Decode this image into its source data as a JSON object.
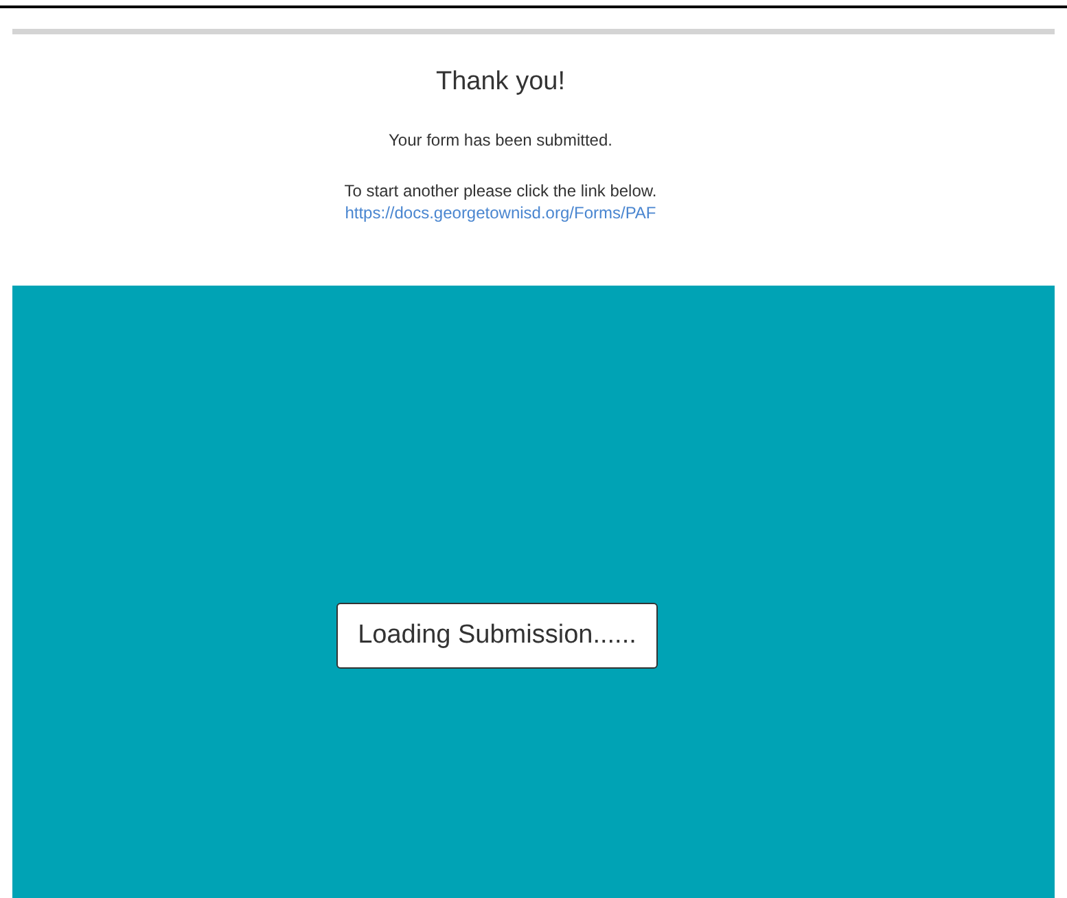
{
  "heading": "Thank you!",
  "message": "Your form has been submitted.",
  "instruction": "To start another please click the link below.",
  "link": "https://docs.georgetownisd.org/Forms/PAF",
  "loading": "Loading Submission......"
}
